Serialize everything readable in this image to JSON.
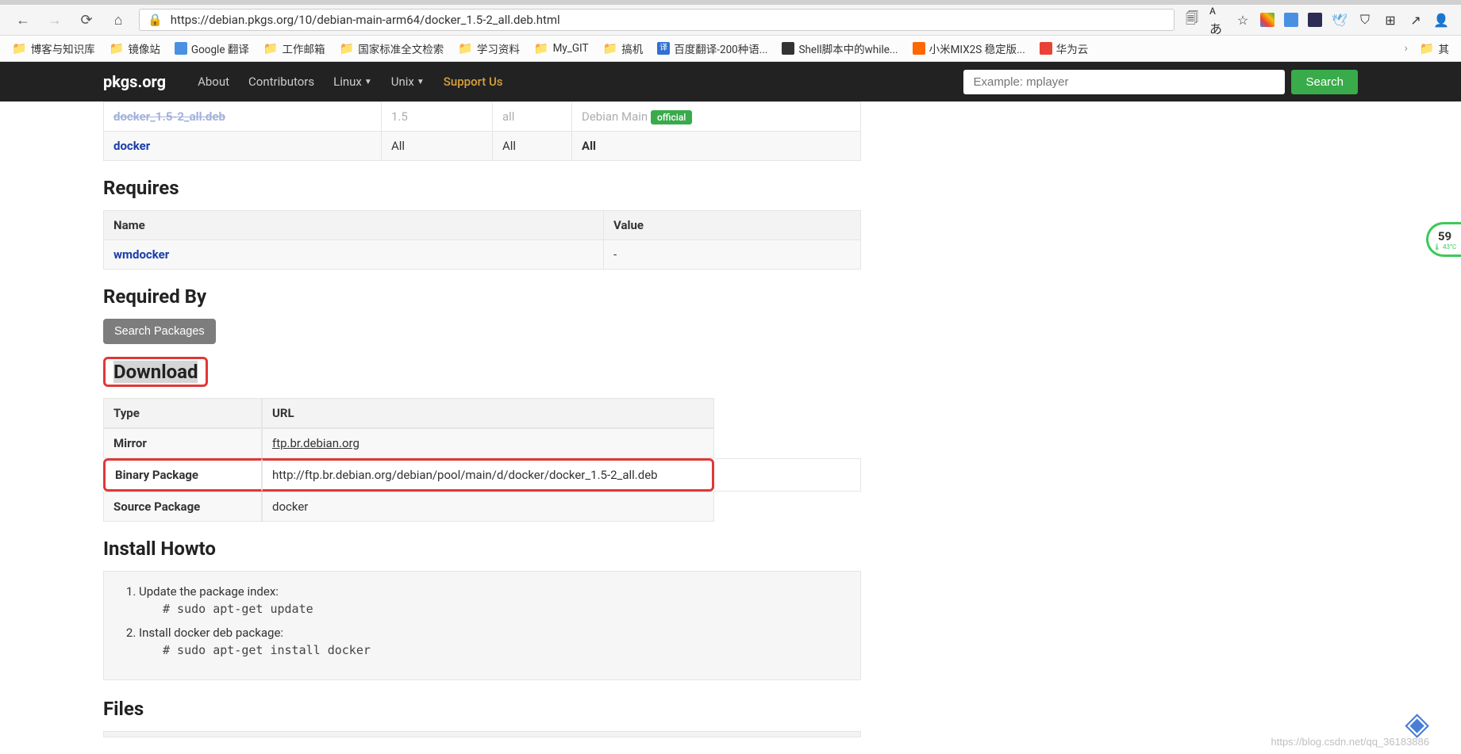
{
  "browser": {
    "url": "https://debian.pkgs.org/10/debian-main-arm64/docker_1.5-2_all.deb.html"
  },
  "bookmarks": [
    {
      "icon": "folder",
      "label": "博客与知识库"
    },
    {
      "icon": "folder",
      "label": "镜像站"
    },
    {
      "icon": "gt",
      "label": "Google 翻译"
    },
    {
      "icon": "folder",
      "label": "工作邮箱"
    },
    {
      "icon": "folder",
      "label": "国家标准全文检索"
    },
    {
      "icon": "folder",
      "label": "学习资料"
    },
    {
      "icon": "folder",
      "label": "My_GIT"
    },
    {
      "icon": "folder",
      "label": "搞机"
    },
    {
      "icon": "bd",
      "label": "百度翻译-200种语..."
    },
    {
      "icon": "shell",
      "label": "Shell脚本中的while..."
    },
    {
      "icon": "mi",
      "label": "小米MIX2S 稳定版..."
    },
    {
      "icon": "hw",
      "label": "华为云"
    }
  ],
  "bookmark_right": {
    "label": "其"
  },
  "site": {
    "logo": "pkgs.org",
    "nav": [
      {
        "label": "About",
        "dropdown": false
      },
      {
        "label": "Contributors",
        "dropdown": false
      },
      {
        "label": "Linux",
        "dropdown": true
      },
      {
        "label": "Unix",
        "dropdown": true
      },
      {
        "label": "Support Us",
        "dropdown": false,
        "highlighted": true
      }
    ],
    "search_placeholder": "Example: mplayer",
    "search_button": "Search"
  },
  "top_table": {
    "rows": [
      {
        "c1": "docker_1.5-2_all.deb",
        "c2": "1.5",
        "c3": "all",
        "c4": "Debian Main",
        "badge": "official"
      },
      {
        "c1": "docker",
        "c2": "All",
        "c3": "All",
        "c4": "All",
        "badge": ""
      }
    ]
  },
  "requires": {
    "title": "Requires",
    "headers": [
      "Name",
      "Value"
    ],
    "rows": [
      {
        "name": "wmdocker",
        "value": "-"
      }
    ]
  },
  "required_by": {
    "title": "Required By",
    "button": "Search Packages"
  },
  "download": {
    "title": "Download",
    "headers": [
      "Type",
      "URL"
    ],
    "rows": [
      {
        "type": "Mirror",
        "url": "ftp.br.debian.org"
      },
      {
        "type": "Binary Package",
        "url": "http://ftp.br.debian.org/debian/pool/main/d/docker/docker_1.5-2_all.deb",
        "highlight": true
      },
      {
        "type": "Source Package",
        "url": "docker"
      }
    ]
  },
  "install": {
    "title": "Install Howto",
    "step1": "Update the package index:",
    "code1": "# sudo apt-get update",
    "step2": "Install docker deb package:",
    "code2": "# sudo apt-get install docker"
  },
  "files": {
    "title": "Files"
  },
  "widget": {
    "main": "59",
    "sub": "🌡 43°C"
  },
  "watermark": "https://blog.csdn.net/qq_36183886"
}
